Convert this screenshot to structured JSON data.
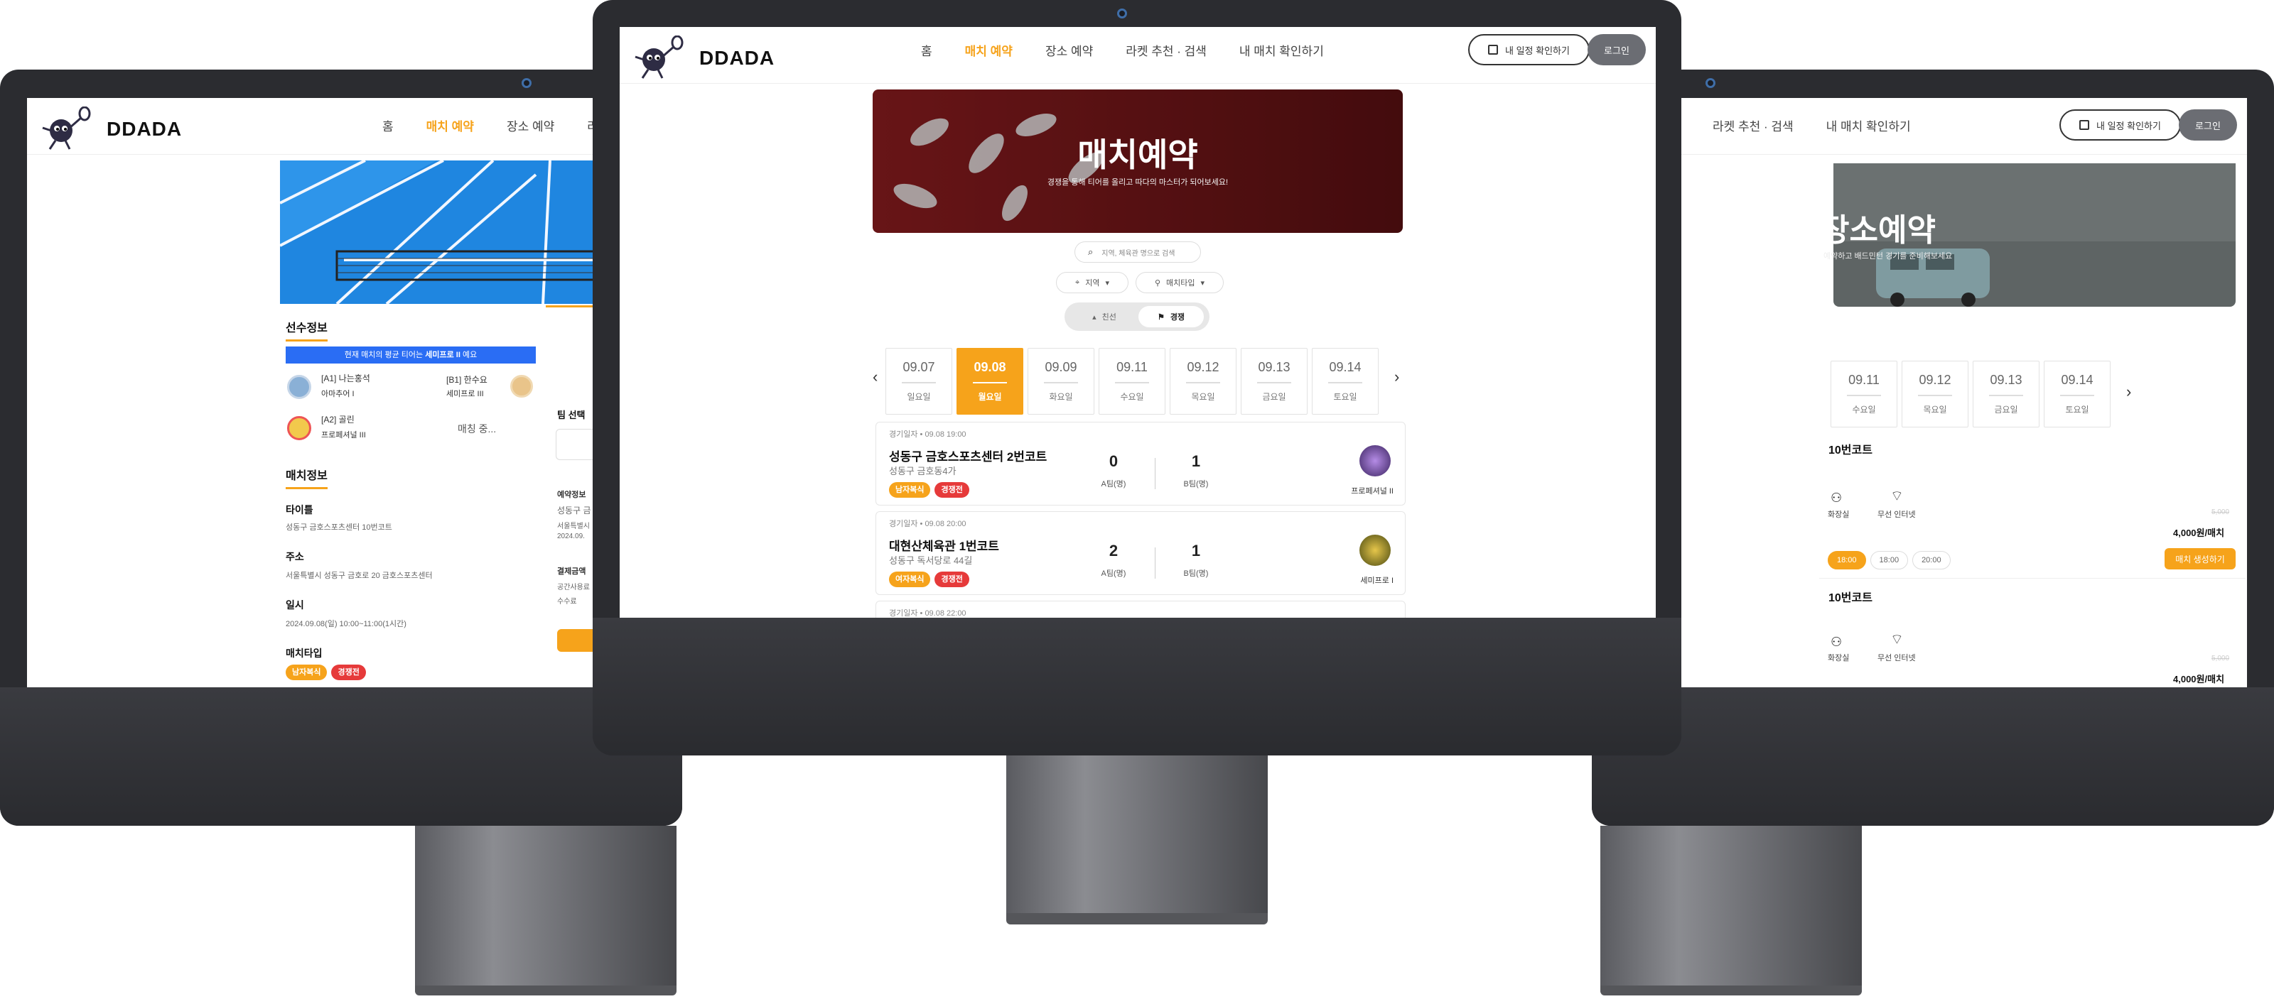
{
  "brand": "DDADA",
  "nav": {
    "home": "홈",
    "match": "매치 예약",
    "venue": "장소 예약",
    "racket": "라켓 추천 · 검색",
    "mymatch": "내 매치 확인하기",
    "racket_cut": "라"
  },
  "header": {
    "schedule_btn": "내 일정 확인하기",
    "login_btn": "로그인"
  },
  "center": {
    "banner_title": "매치예약",
    "banner_sub": "경쟁을 통해 티어를 올리고 따다의 마스터가 되어보세요!",
    "search_placeholder": "지역, 체육관 명으로 검색",
    "filter_region": "지역",
    "filter_type": "매치타입",
    "toggle_friendly": "친선",
    "toggle_competitive": "경쟁",
    "dates": [
      {
        "date": "09.07",
        "day": "일요일"
      },
      {
        "date": "09.08",
        "day": "월요일"
      },
      {
        "date": "09.09",
        "day": "화요일"
      },
      {
        "date": "09.11",
        "day": "수요일"
      },
      {
        "date": "09.12",
        "day": "목요일"
      },
      {
        "date": "09.13",
        "day": "금요일"
      },
      {
        "date": "09.14",
        "day": "토요일"
      }
    ],
    "matches": [
      {
        "datetime": "경기일자 • 09.08 19:00",
        "place": "성동구 금호스포츠센터 2번코트",
        "addr": "성동구 금호동4가",
        "tag1": "남자복식",
        "tag2": "경쟁전",
        "a": "0",
        "b": "1",
        "a_lbl": "A팀(명)",
        "b_lbl": "B팀(명)",
        "tier": "프로페셔널 II"
      },
      {
        "datetime": "경기일자 • 09.08 20:00",
        "place": "대현산체육관 1번코트",
        "addr": "성동구 독서당로 44길",
        "tag1": "여자복식",
        "tag2": "경쟁전",
        "a": "2",
        "b": "1",
        "a_lbl": "A팀(명)",
        "b_lbl": "B팀(명)",
        "tier": "세미프로 I"
      },
      {
        "datetime": "경기일자 • 09.08 22:00"
      }
    ]
  },
  "left": {
    "players_title": "선수정보",
    "tier_banner_a": "현재 매치의 평균 티어는 ",
    "tier_banner_b": "세미프로 II",
    "tier_banner_c": " 예요",
    "players": [
      {
        "slot": "[A1] 나는홍석",
        "tier": "아마추어 I"
      },
      {
        "slot": "[B1] 한수요",
        "tier": "세미프로 III"
      },
      {
        "slot": "[A2] 골린",
        "tier": "프로페셔널 III"
      }
    ],
    "matching": "매칭 중...",
    "team_select": "팀 선택",
    "info_title": "매치정보",
    "title_lbl": "타이틀",
    "title_val": "성동구 금호스포츠센터 10번코트",
    "addr_lbl": "주소",
    "addr_val": "서울특별시 성동구 금호로 20 금호스포츠센터",
    "date_lbl": "일시",
    "date_val": "2024.09.08(일) 10:00~11:00(1시간)",
    "type_lbl": "매치타입",
    "type_tag1": "남자복식",
    "type_tag2": "경쟁전",
    "side_a": "예약정보",
    "side_b": "성동구 금",
    "side_c": "서울특별시",
    "side_d": "2024.09.",
    "side_e": "결제금액",
    "side_f": "공간사용료",
    "side_g": "수수료"
  },
  "right": {
    "banner_title": "장소예약",
    "banner_sub": "예약하고 배드민턴 경기를 준비해보세요",
    "dates": [
      {
        "date": "09.11",
        "day": "수요일"
      },
      {
        "date": "09.12",
        "day": "목요일"
      },
      {
        "date": "09.13",
        "day": "금요일"
      },
      {
        "date": "09.14",
        "day": "토요일"
      }
    ],
    "court1": "10번코트",
    "court2": "10번코트",
    "fac_toilet": "화장실",
    "fac_wifi": "무선 인터넷",
    "old_price": "5,000",
    "price": "4,000원/매치",
    "slots": [
      "18:00",
      "18:00",
      "20:00"
    ],
    "book_btn": "매치 생성하기"
  }
}
